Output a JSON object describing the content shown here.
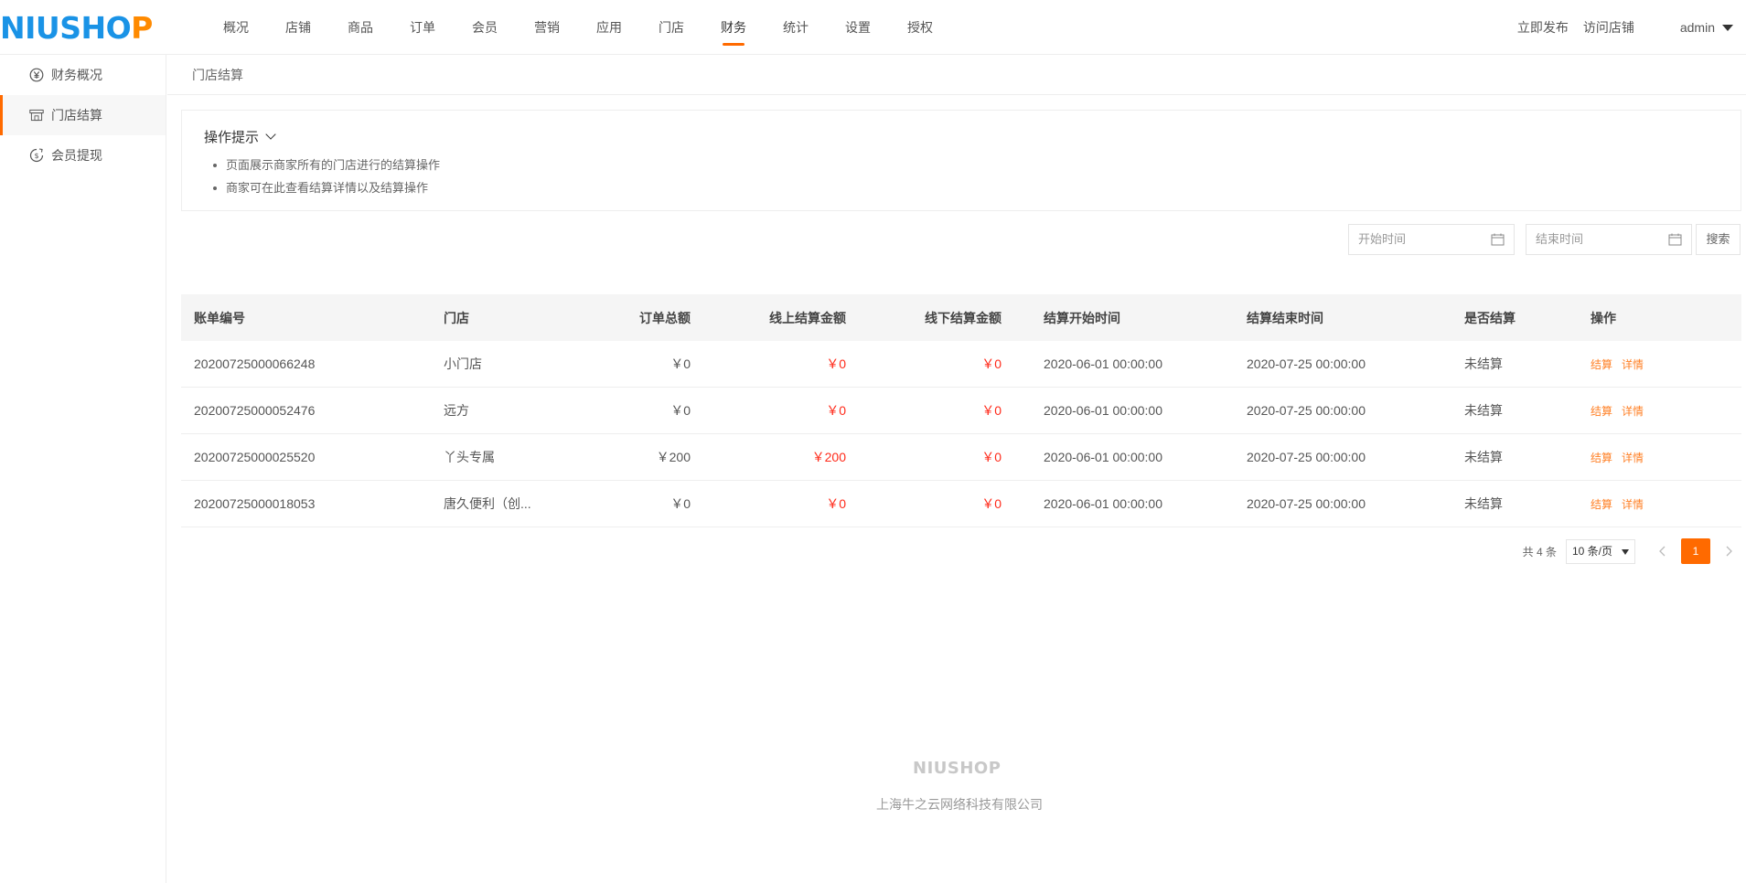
{
  "brand": {
    "logo_a": "NIU",
    "logo_b": "SHO",
    "logo_c": "P"
  },
  "nav": [
    "概况",
    "店铺",
    "商品",
    "订单",
    "会员",
    "营销",
    "应用",
    "门店",
    "财务",
    "统计",
    "设置",
    "授权"
  ],
  "nav_active": "财务",
  "header_right": {
    "publish": "立即发布",
    "visit": "访问店铺",
    "user": "admin"
  },
  "sidebar": [
    {
      "label": "财务概况",
      "icon": "yen-circle-icon"
    },
    {
      "label": "门店结算",
      "icon": "store-icon",
      "active": true
    },
    {
      "label": "会员提现",
      "icon": "withdraw-icon"
    }
  ],
  "breadcrumb": "门店结算",
  "tips": {
    "title": "操作提示",
    "items": [
      "页面展示商家所有的门店进行的结算操作",
      "商家可在此查看结算详情以及结算操作"
    ]
  },
  "search": {
    "start_placeholder": "开始时间",
    "end_placeholder": "结束时间",
    "button": "搜索"
  },
  "table": {
    "headers": [
      "账单编号",
      "门店",
      "订单总额",
      "线上结算金额",
      "线下结算金额",
      "结算开始时间",
      "结算结束时间",
      "是否结算",
      "操作"
    ],
    "rows": [
      [
        "20200725000066248",
        "小门店",
        "￥0",
        "￥0",
        "￥0",
        "2020-06-01 00:00:00",
        "2020-07-25 00:00:00",
        "未结算"
      ],
      [
        "20200725000052476",
        "远方",
        "￥0",
        "￥0",
        "￥0",
        "2020-06-01 00:00:00",
        "2020-07-25 00:00:00",
        "未结算"
      ],
      [
        "20200725000025520",
        "丫头专属",
        "￥200",
        "￥200",
        "￥0",
        "2020-06-01 00:00:00",
        "2020-07-25 00:00:00",
        "未结算"
      ],
      [
        "20200725000018053",
        "唐久便利（创...",
        "￥0",
        "￥0",
        "￥0",
        "2020-06-01 00:00:00",
        "2020-07-25 00:00:00",
        "未结算"
      ]
    ],
    "actions": [
      "结算",
      "详情"
    ]
  },
  "pager": {
    "total": "共 4 条",
    "page_size": "10 条/页",
    "current": "1"
  },
  "footer": {
    "logo": "NIUSHOP",
    "company": "上海牛之云网络科技有限公司"
  },
  "colors": {
    "accent": "#ff6a00",
    "money_red": "#ff2a1a",
    "logo_blue": "#1a93e6"
  }
}
